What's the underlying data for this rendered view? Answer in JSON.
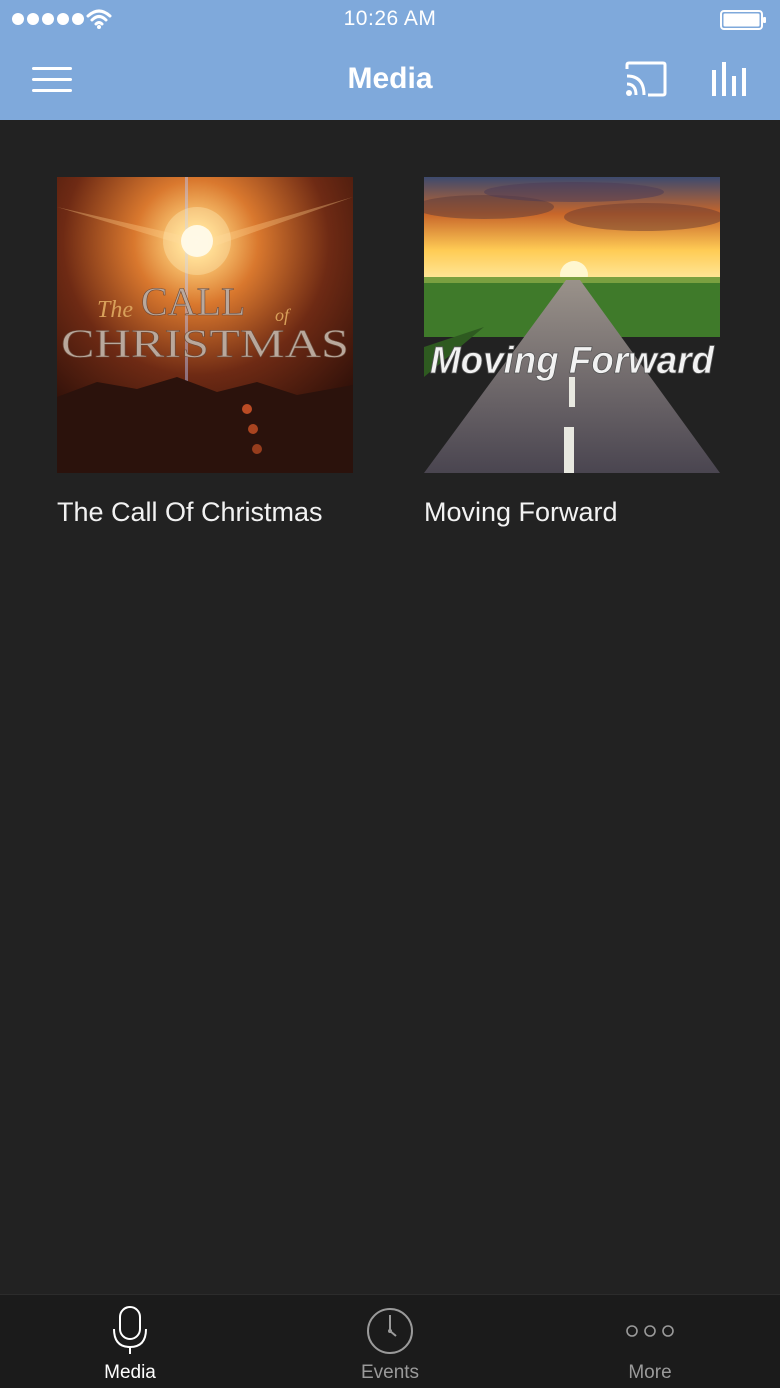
{
  "status_bar": {
    "time": "10:26 AM",
    "signal_icon": "signal-dots-icon",
    "wifi_icon": "wifi-icon",
    "battery_icon": "battery-icon"
  },
  "nav": {
    "title": "Media",
    "menu_icon": "hamburger-icon",
    "cast_icon": "cast-icon",
    "stats_icon": "bar-chart-icon"
  },
  "media": [
    {
      "title": "The Call Of Christmas",
      "art_lines": [
        "The",
        "CALL",
        "of",
        "CHRISTMAS"
      ]
    },
    {
      "title": "Moving Forward",
      "art_lines": [
        "Moving Forward"
      ]
    }
  ],
  "tabs": [
    {
      "label": "Media",
      "icon": "microphone-icon",
      "active": true
    },
    {
      "label": "Events",
      "icon": "clock-icon",
      "active": false
    },
    {
      "label": "More",
      "icon": "more-dots-icon",
      "active": false
    }
  ],
  "colors": {
    "header": "#7fa9db",
    "background": "#222222",
    "tabbar": "#1b1b1b"
  }
}
